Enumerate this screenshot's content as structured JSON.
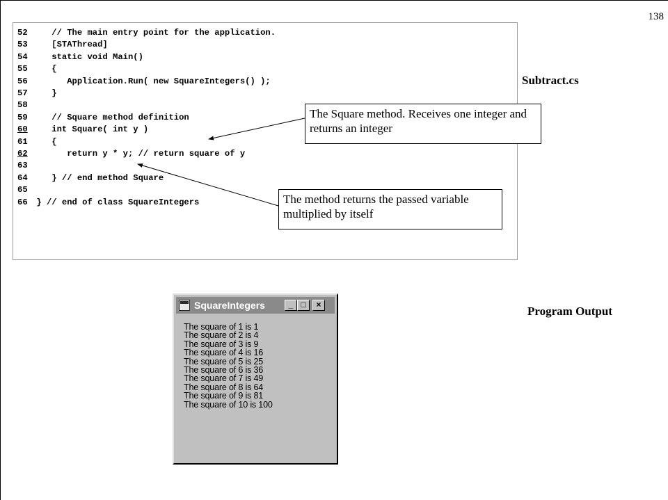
{
  "page_number": "138",
  "file_label": "Subtract.cs",
  "output_label": "Program Output",
  "code_lines": [
    {
      "num": "52",
      "text": "    // The main entry point for the application.",
      "underlined": false
    },
    {
      "num": "53",
      "text": "    [STAThread]",
      "underlined": false
    },
    {
      "num": "54",
      "text": "    static void Main()",
      "underlined": false
    },
    {
      "num": "55",
      "text": "    {",
      "underlined": false
    },
    {
      "num": "56",
      "text": "       Application.Run( new SquareIntegers() );",
      "underlined": false
    },
    {
      "num": "57",
      "text": "    }",
      "underlined": false
    },
    {
      "num": "58",
      "text": "",
      "underlined": false
    },
    {
      "num": "59",
      "text": "    // Square method definition",
      "underlined": false
    },
    {
      "num": "60",
      "text": "    int Square( int y )",
      "underlined": true
    },
    {
      "num": "61",
      "text": "    {",
      "underlined": false
    },
    {
      "num": "62",
      "text": "       return y * y; // return square of y",
      "underlined": true
    },
    {
      "num": "63",
      "text": "",
      "underlined": false
    },
    {
      "num": "64",
      "text": "    } // end method Square",
      "underlined": false
    },
    {
      "num": "65",
      "text": "",
      "underlined": false
    },
    {
      "num": "66",
      "text": " } // end of class SquareIntegers",
      "underlined": false
    }
  ],
  "callouts": {
    "square_method": "The Square method.  Receives one integer and returns an integer",
    "returns": "The method returns the passed variable multiplied by itself"
  },
  "window": {
    "title": "SquareIntegers",
    "icon": "application-icon",
    "buttons": {
      "minimize": "_",
      "maximize": "□",
      "close": "×"
    },
    "output_lines": [
      "The square of 1 is 1",
      "The square of 2 is 4",
      "The square of 3 is 9",
      "The square of 4 is 16",
      "The square of 5 is 25",
      "The square of 6 is 36",
      "The square of 7 is 49",
      "The square of 8 is 64",
      "The square of 9 is 81",
      "The square of 10 is 100"
    ]
  }
}
